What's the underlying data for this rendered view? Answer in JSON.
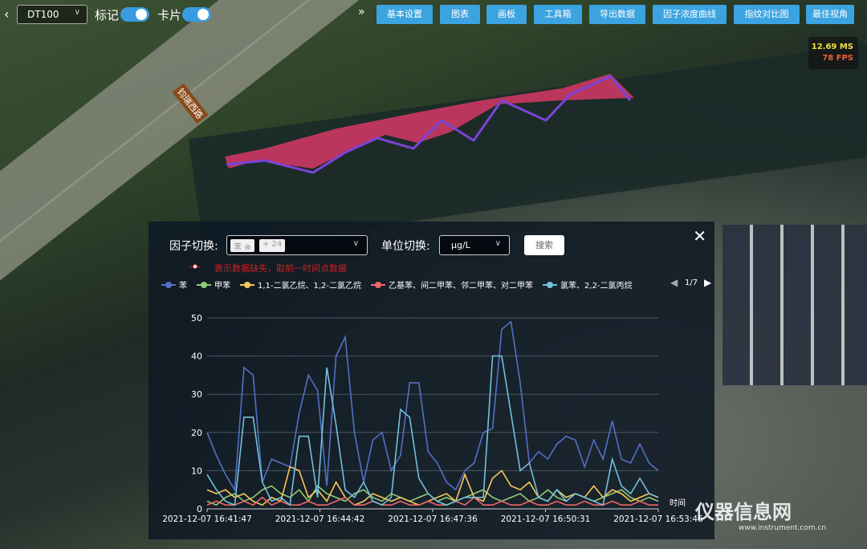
{
  "topbar": {
    "device": "DT100",
    "mark_label": "标记",
    "card_label": "卡片",
    "mark_on": true,
    "card_on": true,
    "buttons": [
      "基本设置",
      "图表",
      "画板",
      "工具箱",
      "导出数据",
      "因子浓度曲线",
      "指纹对比图",
      "最佳视角"
    ]
  },
  "stats": {
    "ms": "12.69 MS",
    "fps": "78 FPS"
  },
  "map": {
    "road_label": "钧瑞西路"
  },
  "panel": {
    "factor_label": "因子切换:",
    "factor_tag": "苯",
    "factor_more": "+ 24",
    "unit_label": "单位切换:",
    "unit_value": "μg/L",
    "search_label": "搜索",
    "missing_note": "表示数据缺失，取前一时间点数据",
    "legend_page": "1/7"
  },
  "chart_data": {
    "type": "line",
    "ylim": [
      0,
      50
    ],
    "yticks": [
      0,
      10,
      20,
      30,
      40,
      50
    ],
    "xlabel": "时间",
    "xticks": [
      "2021-12-07 16:41:47",
      "2021-12-07 16:44:42",
      "2021-12-07 16:47:36",
      "2021-12-07 16:50:31",
      "2021-12-07 16:53:46"
    ],
    "series": [
      {
        "name": "苯",
        "color": "#5470c6",
        "values": [
          20,
          14,
          9,
          5,
          37,
          35,
          7,
          13,
          12,
          11,
          25,
          35,
          31,
          6,
          40,
          45,
          20,
          7,
          18,
          20,
          10,
          14,
          33,
          33,
          15,
          12,
          7,
          5,
          10,
          12,
          20,
          21,
          47,
          49,
          33,
          12,
          15,
          13,
          17,
          19,
          18,
          11,
          18,
          13,
          23,
          13,
          12,
          17,
          12,
          10
        ]
      },
      {
        "name": "甲苯",
        "color": "#91cc75",
        "values": [
          2,
          1,
          3,
          4,
          2,
          3,
          5,
          6,
          4,
          3,
          5,
          2,
          6,
          4,
          3,
          2,
          4,
          5,
          3,
          2,
          4,
          3,
          2,
          3,
          4,
          2,
          3,
          2,
          3,
          4,
          5,
          3,
          2,
          3,
          4,
          2,
          3,
          5,
          3,
          2,
          4,
          3,
          2,
          3,
          4,
          5,
          3,
          2,
          3,
          2
        ]
      },
      {
        "name": "1,1-二氯乙烷、1,2-二氯乙烷",
        "color": "#fac858",
        "values": [
          5,
          4,
          5,
          3,
          4,
          2,
          1,
          3,
          2,
          11,
          10,
          3,
          5,
          2,
          7,
          3,
          1,
          2,
          4,
          3,
          2,
          3,
          2,
          1,
          2,
          3,
          4,
          2,
          9,
          3,
          2,
          8,
          10,
          6,
          5,
          7,
          3,
          2,
          5,
          3,
          4,
          3,
          6,
          3,
          5,
          4,
          2,
          3,
          4,
          3
        ]
      },
      {
        "name": "乙基苯、间二甲苯、邻二甲苯、对二甲苯",
        "color": "#ee6666",
        "values": [
          1,
          2,
          1,
          1,
          2,
          1,
          3,
          1,
          2,
          1,
          1,
          2,
          1,
          1,
          2,
          3,
          1,
          1,
          2,
          1,
          1,
          2,
          1,
          1,
          2,
          1,
          1,
          2,
          1,
          3,
          1,
          1,
          2,
          1,
          1,
          2,
          1,
          1,
          2,
          1,
          1,
          2,
          1,
          1,
          2,
          1,
          1,
          2,
          1,
          1
        ]
      },
      {
        "name": "氯苯、2,2-二氯丙烷",
        "color": "#73c0de",
        "values": [
          9,
          5,
          2,
          1,
          24,
          24,
          7,
          2,
          3,
          1,
          19,
          19,
          3,
          37,
          22,
          5,
          3,
          7,
          2,
          1,
          3,
          26,
          24,
          8,
          4,
          2,
          1,
          2,
          3,
          3,
          3,
          40,
          40,
          25,
          10,
          12,
          3,
          2,
          5,
          2,
          4,
          3,
          2,
          1,
          13,
          6,
          4,
          8,
          4,
          3
        ]
      }
    ]
  },
  "watermark": {
    "text": "仪器信息网",
    "url": "www.instrument.com.cn"
  }
}
